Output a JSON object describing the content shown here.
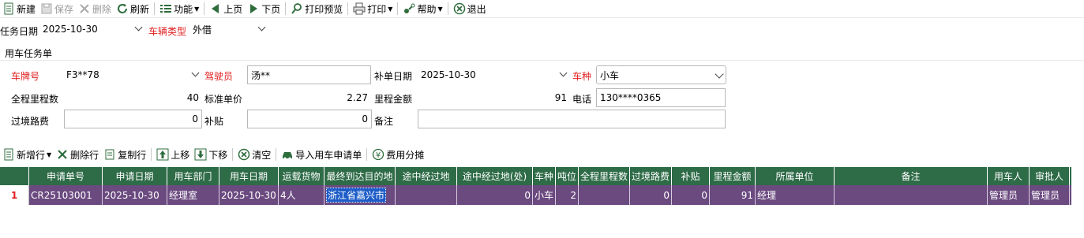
{
  "toolbar": {
    "new": "新建",
    "save": "保存",
    "delete": "删除",
    "refresh": "刷新",
    "function": "功能",
    "prev": "上页",
    "next": "下页",
    "print_preview": "打印预览",
    "print": "打印",
    "help": "帮助",
    "exit": "退出"
  },
  "filter": {
    "task_date_label": "任务日期",
    "task_date_value": "2025-10-30",
    "vehicle_type_label": "车辆类型",
    "vehicle_type_value": "外借"
  },
  "form": {
    "group_title": "用车任务单",
    "plate_label": "车牌号",
    "plate_value": "F3**78",
    "driver_label": "驾驶员",
    "driver_value": "汤**",
    "supp_date_label": "补单日期",
    "supp_date_value": "2025-10-30",
    "car_kind_label": "车种",
    "car_kind_value": "小车",
    "total_mileage_label": "全程里程数",
    "total_mileage_value": "40",
    "std_price_label": "标准单价",
    "std_price_value": "2.27",
    "mileage_amount_label": "里程金额",
    "mileage_amount_value": "91",
    "phone_label": "电话",
    "phone_value": "130****0365",
    "toll_label": "过境路费",
    "toll_value": "0",
    "subsidy_label": "补贴",
    "subsidy_value": "0",
    "remark_label": "备注",
    "remark_value": ""
  },
  "grid_toolbar": {
    "add_row": "新增行",
    "delete_row": "删除行",
    "copy_row": "复制行",
    "move_up": "上移",
    "move_down": "下移",
    "clear": "清空",
    "import": "导入用车申请单",
    "cost_split": "费用分摊"
  },
  "grid": {
    "headers": [
      "申请单号",
      "申请日期",
      "用车部门",
      "用车日期",
      "运载货物",
      "最终到达目的地",
      "途中经过地",
      "途中经过地(处)",
      "车种",
      "吨位",
      "全程里程数",
      "过境路费",
      "补贴",
      "里程金额",
      "所属单位",
      "备注",
      "用车人",
      "审批人"
    ],
    "rows": [
      {
        "num": "1",
        "cells": [
          "CR25103001",
          "2025-10-30",
          "经理室",
          "2025-10-30",
          "4人",
          "浙江省嘉兴市",
          "",
          "0",
          "小车",
          "2",
          "",
          "0",
          "0",
          "91",
          "经理",
          "",
          "管理员",
          "管理员"
        ]
      }
    ]
  },
  "colors": {
    "header_bg": "#2e6b47",
    "row_bg": "#6b4a80",
    "required_label": "#e02020",
    "selection": "#1d5cc8"
  }
}
